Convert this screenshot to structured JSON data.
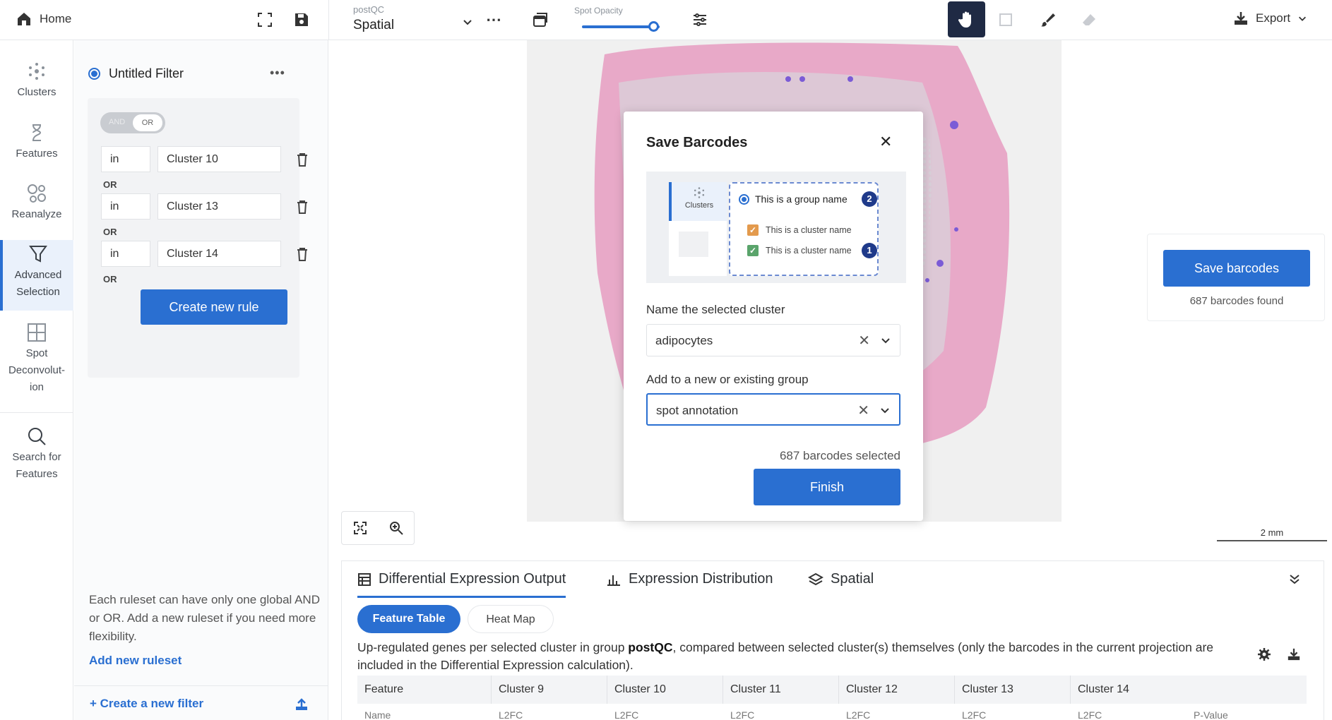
{
  "topbar": {
    "home_label": "Home",
    "projection_label": "postQC",
    "projection_value": "Spatial",
    "opacity_label": "Spot Opacity",
    "opacity_value": 0.92,
    "export_label": "Export"
  },
  "rail": {
    "items": [
      {
        "label": "Clusters",
        "icon": "clusters-icon"
      },
      {
        "label": "Features",
        "icon": "features-icon"
      },
      {
        "label": "Reanalyze",
        "icon": "reanalyze-icon"
      },
      {
        "label": "Advanced Selection",
        "icon": "filter-icon"
      },
      {
        "label": "Spot Deconvolut-ion",
        "icon": "grid-icon"
      },
      {
        "label": "Search for Features",
        "icon": "search-icon"
      }
    ]
  },
  "filter": {
    "title": "Untitled Filter",
    "toggle_and": "AND",
    "toggle_or": "OR",
    "rules": [
      {
        "op": "in",
        "value": "Cluster 10"
      },
      {
        "op": "in",
        "value": "Cluster 13"
      },
      {
        "op": "in",
        "value": "Cluster 14"
      }
    ],
    "or_label": "OR",
    "create_rule_label": "Create new rule",
    "help_text": "Each ruleset can have only one global AND or OR. Add a new ruleset if you need more flexibility.",
    "add_ruleset_label": "Add new ruleset",
    "create_filter_label": "+ Create a new filter"
  },
  "modal": {
    "title": "Save Barcodes",
    "illus_rail_label": "Clusters",
    "illus_group_label": "This is a group name",
    "illus_badge_group": "2",
    "illus_cluster_a": "This is a cluster name",
    "illus_cluster_b": "This is a cluster name",
    "illus_badge_cluster": "1",
    "name_label": "Name the selected cluster",
    "name_value": "adipocytes",
    "group_label": "Add to a new or existing group",
    "group_value": "spot annotation",
    "selected_count": "687 barcodes selected",
    "finish_label": "Finish",
    "colors": {
      "check_orange": "#e39a4d",
      "check_green": "#5aa46b"
    }
  },
  "save_card": {
    "button_label": "Save barcodes",
    "found_text": "687 barcodes found"
  },
  "scale_label": "2 mm",
  "bottom": {
    "tabs": [
      {
        "label": "Differential Expression Output",
        "icon": "table-icon"
      },
      {
        "label": "Expression Distribution",
        "icon": "distribution-icon"
      },
      {
        "label": "Spatial",
        "icon": "layers-icon"
      }
    ],
    "pill_feature": "Feature Table",
    "pill_heatmap": "Heat Map",
    "desc_pre": "Up-regulated genes per selected cluster in group ",
    "desc_bold": "postQC",
    "desc_post": ", compared between selected cluster(s) themselves (only the barcodes in the current projection are included in the Differential Expression calculation).",
    "columns": [
      "Feature",
      "Cluster 9",
      "Cluster 10",
      "Cluster 11",
      "Cluster 12",
      "Cluster 13",
      "Cluster 14"
    ],
    "subcols": [
      "Name",
      "L2FC",
      "L2FC",
      "L2FC",
      "L2FC",
      "L2FC",
      "L2FC",
      "P-Value"
    ]
  },
  "colors": {
    "accent": "#2a6fd1",
    "spot": "#7b5bd6",
    "tissue": "#e8a9c8"
  }
}
